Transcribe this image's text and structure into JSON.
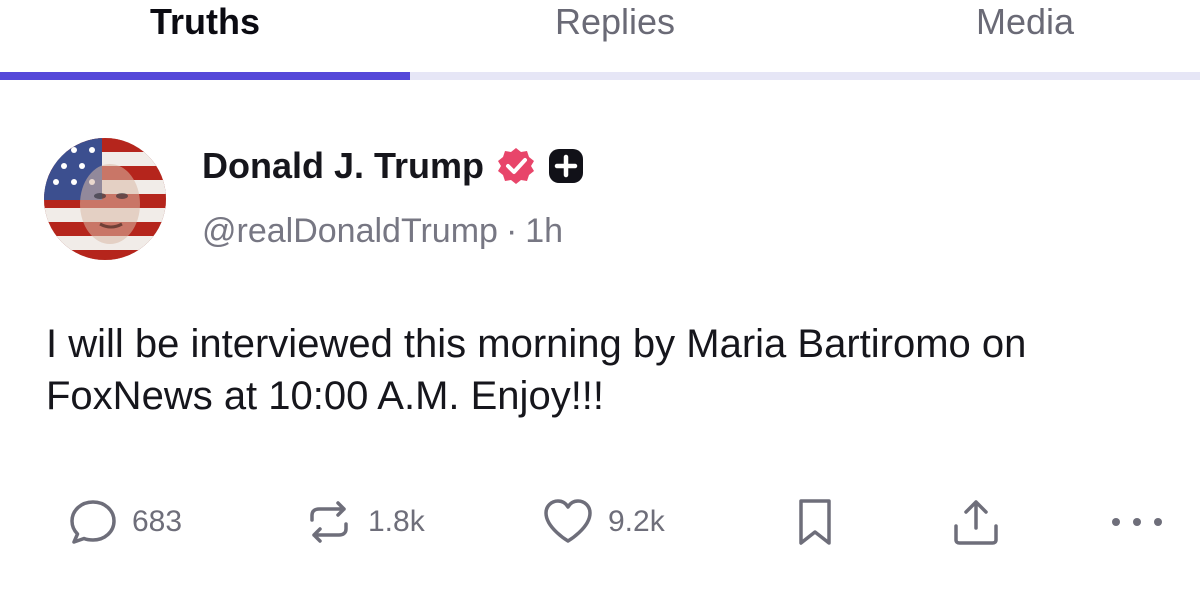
{
  "tabs": [
    {
      "label": "Truths",
      "active": true
    },
    {
      "label": "Replies",
      "active": false
    },
    {
      "label": "Media",
      "active": false
    }
  ],
  "colors": {
    "accent": "#5548d9",
    "verified": "#e8456a"
  },
  "post": {
    "author_name": "Donald J. Trump",
    "handle": "@realDonaldTrump",
    "separator": "·",
    "time": "1h",
    "verified_icon": "verified-badge-icon",
    "plus_icon": "plus-badge-icon",
    "text": "I will be interviewed this morning by Maria Bartiromo on FoxNews at 10:00 A.M. Enjoy!!!",
    "actions": {
      "replies": "683",
      "retruths": "1.8k",
      "likes": "9.2k"
    }
  }
}
